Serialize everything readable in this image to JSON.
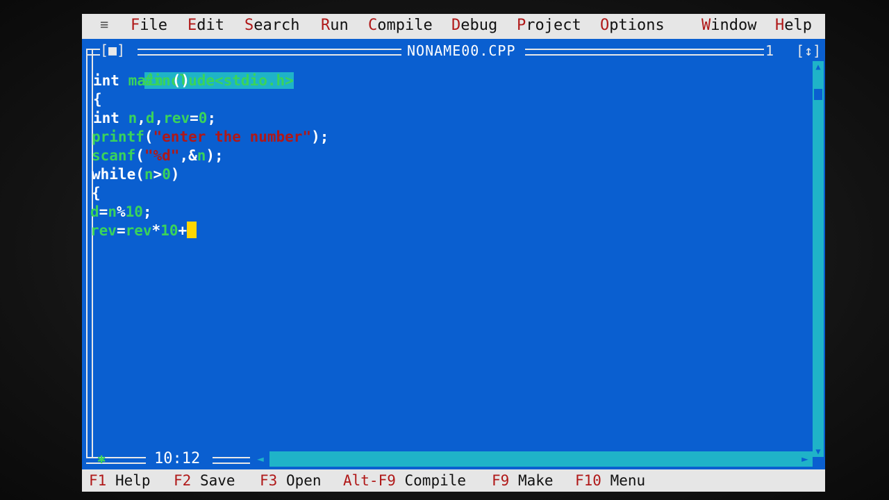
{
  "menu": {
    "system": "≡",
    "items": [
      {
        "hot": "F",
        "rest": "ile"
      },
      {
        "hot": "E",
        "rest": "dit"
      },
      {
        "hot": "S",
        "rest": "earch"
      },
      {
        "hot": "R",
        "rest": "un"
      },
      {
        "hot": "C",
        "rest": "ompile"
      },
      {
        "hot": "D",
        "rest": "ebug"
      },
      {
        "hot": "P",
        "rest": "roject"
      },
      {
        "hot": "O",
        "rest": "ptions"
      },
      {
        "hot": "W",
        "rest": "indow"
      },
      {
        "hot": "H",
        "rest": "elp"
      }
    ]
  },
  "window": {
    "control": "[■]",
    "title": "NONAME00.CPP",
    "number": "1",
    "close": "[↕]"
  },
  "editor": {
    "lines": [
      [
        {
          "t": "#include<stdio.h>",
          "c": "pp"
        }
      ],
      [
        {
          "t": "int ",
          "c": "kw"
        },
        {
          "t": "main ",
          "c": "id"
        },
        {
          "t": "()",
          "c": "op"
        }
      ],
      [
        {
          "t": "{",
          "c": "op"
        }
      ],
      [
        {
          "t": "int ",
          "c": "kw"
        },
        {
          "t": "n",
          "c": "id"
        },
        {
          "t": ",",
          "c": "op"
        },
        {
          "t": "d",
          "c": "id"
        },
        {
          "t": ",",
          "c": "op"
        },
        {
          "t": "rev",
          "c": "id"
        },
        {
          "t": "=",
          "c": "op"
        },
        {
          "t": "0",
          "c": "num"
        },
        {
          "t": ";",
          "c": "op"
        }
      ],
      [
        {
          "t": "printf",
          "c": "fn"
        },
        {
          "t": "(",
          "c": "op"
        },
        {
          "t": "\"enter the number\"",
          "c": "str"
        },
        {
          "t": ");",
          "c": "op"
        }
      ],
      [
        {
          "t": "scanf",
          "c": "fn"
        },
        {
          "t": "(",
          "c": "op"
        },
        {
          "t": "\"%d\"",
          "c": "str"
        },
        {
          "t": ",&",
          "c": "op"
        },
        {
          "t": "n",
          "c": "id"
        },
        {
          "t": ");",
          "c": "op"
        }
      ],
      [
        {
          "t": "while",
          "c": "kw"
        },
        {
          "t": "(",
          "c": "op"
        },
        {
          "t": "n",
          "c": "id"
        },
        {
          "t": ">",
          "c": "op"
        },
        {
          "t": "0",
          "c": "num"
        },
        {
          "t": ")",
          "c": "op"
        }
      ],
      [
        {
          "t": "{",
          "c": "op"
        }
      ],
      [
        {
          "t": "d",
          "c": "id"
        },
        {
          "t": "=",
          "c": "op"
        },
        {
          "t": "n",
          "c": "id"
        },
        {
          "t": "%",
          "c": "op"
        },
        {
          "t": "10",
          "c": "num"
        },
        {
          "t": ";",
          "c": "op"
        }
      ],
      [
        {
          "t": "rev",
          "c": "id"
        },
        {
          "t": "=",
          "c": "op"
        },
        {
          "t": "rev",
          "c": "id"
        },
        {
          "t": "*",
          "c": "op"
        },
        {
          "t": "10",
          "c": "num"
        },
        {
          "t": "+",
          "c": "op"
        }
      ]
    ]
  },
  "cursor_position": "10:12",
  "status": {
    "keys": [
      {
        "key": "F1",
        "label": "Help"
      },
      {
        "key": "F2",
        "label": "Save"
      },
      {
        "key": "F3",
        "label": "Open"
      },
      {
        "key": "Alt-F9",
        "label": "Compile"
      },
      {
        "key": "F9",
        "label": "Make"
      },
      {
        "key": "F10",
        "label": "Menu"
      }
    ]
  },
  "colors": {
    "editor_bg": "#0a5fd0",
    "menu_bg": "#e6e6e6",
    "hotkey": "#b01818",
    "scrollbar": "#1fb3c8",
    "cursor": "#ffd700"
  }
}
